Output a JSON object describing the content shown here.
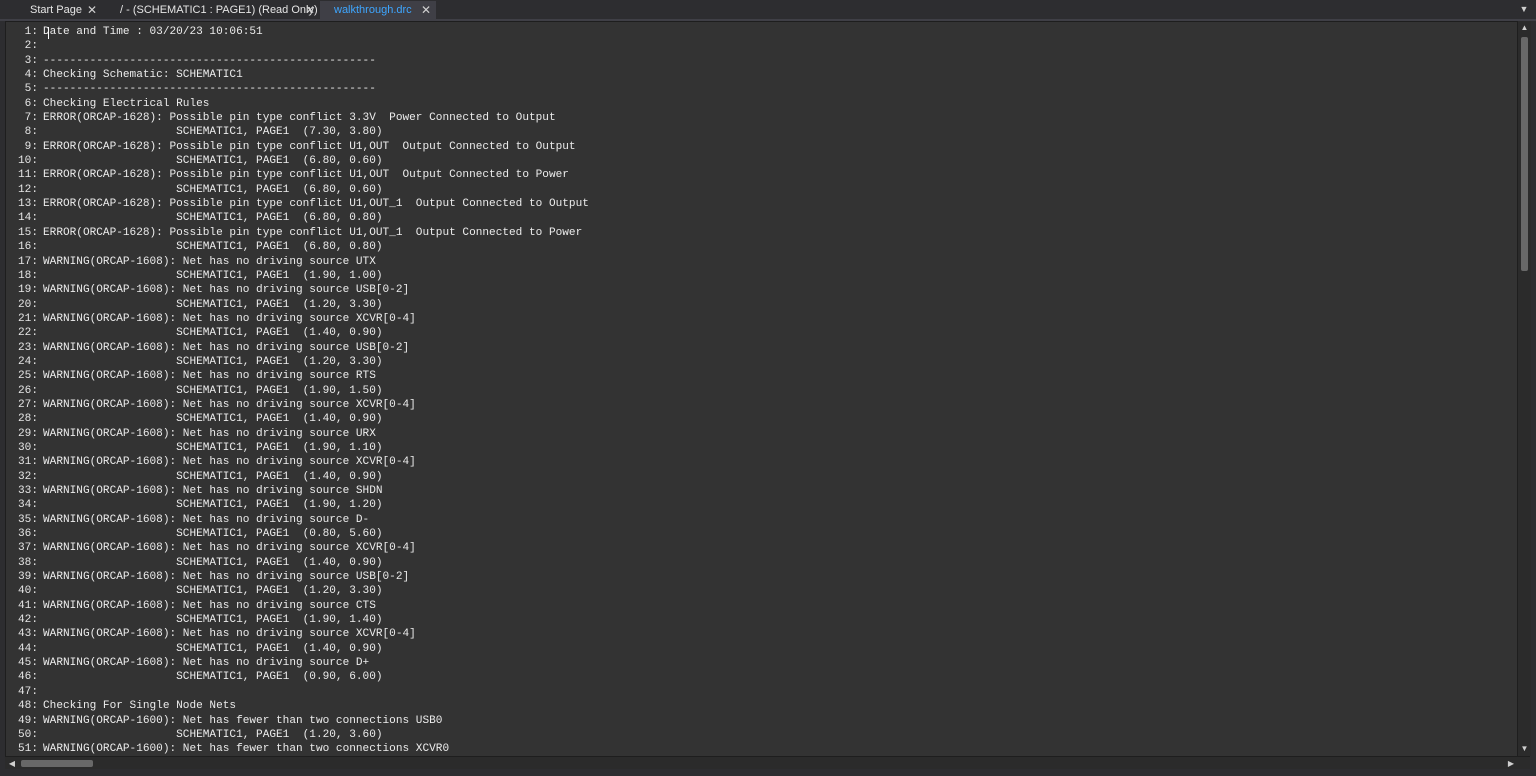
{
  "tabs": [
    {
      "label": "Start Page",
      "close": "✕",
      "active": false
    },
    {
      "label": "/ - (SCHEMATIC1 : PAGE1) (Read Only)",
      "close": "✕",
      "active": false
    },
    {
      "label": "walkthrough.drc",
      "close": "✕",
      "active": true
    }
  ],
  "tab_dropdown_icon": "chevron-down-icon",
  "colors": {
    "active_tab_text": "#3ea6ff",
    "editor_bg": "#333333",
    "text": "#ececec"
  },
  "lines": [
    {
      "num": "1:",
      "text": "Date and Time : 03/20/23 10:06:51"
    },
    {
      "num": "2:",
      "text": ""
    },
    {
      "num": "3:",
      "text": "--------------------------------------------------"
    },
    {
      "num": "4:",
      "text": "Checking Schematic: SCHEMATIC1"
    },
    {
      "num": "5:",
      "text": "--------------------------------------------------"
    },
    {
      "num": "6:",
      "text": "Checking Electrical Rules"
    },
    {
      "num": "7:",
      "text": "ERROR(ORCAP-1628): Possible pin type conflict 3.3V  Power Connected to Output"
    },
    {
      "num": "8:",
      "text": "                    SCHEMATIC1, PAGE1  (7.30, 3.80)"
    },
    {
      "num": "9:",
      "text": "ERROR(ORCAP-1628): Possible pin type conflict U1,OUT  Output Connected to Output"
    },
    {
      "num": "10:",
      "text": "                    SCHEMATIC1, PAGE1  (6.80, 0.60)"
    },
    {
      "num": "11:",
      "text": "ERROR(ORCAP-1628): Possible pin type conflict U1,OUT  Output Connected to Power"
    },
    {
      "num": "12:",
      "text": "                    SCHEMATIC1, PAGE1  (6.80, 0.60)"
    },
    {
      "num": "13:",
      "text": "ERROR(ORCAP-1628): Possible pin type conflict U1,OUT_1  Output Connected to Output"
    },
    {
      "num": "14:",
      "text": "                    SCHEMATIC1, PAGE1  (6.80, 0.80)"
    },
    {
      "num": "15:",
      "text": "ERROR(ORCAP-1628): Possible pin type conflict U1,OUT_1  Output Connected to Power"
    },
    {
      "num": "16:",
      "text": "                    SCHEMATIC1, PAGE1  (6.80, 0.80)"
    },
    {
      "num": "17:",
      "text": "WARNING(ORCAP-1608): Net has no driving source UTX"
    },
    {
      "num": "18:",
      "text": "                    SCHEMATIC1, PAGE1  (1.90, 1.00)"
    },
    {
      "num": "19:",
      "text": "WARNING(ORCAP-1608): Net has no driving source USB[0-2]"
    },
    {
      "num": "20:",
      "text": "                    SCHEMATIC1, PAGE1  (1.20, 3.30)"
    },
    {
      "num": "21:",
      "text": "WARNING(ORCAP-1608): Net has no driving source XCVR[0-4]"
    },
    {
      "num": "22:",
      "text": "                    SCHEMATIC1, PAGE1  (1.40, 0.90)"
    },
    {
      "num": "23:",
      "text": "WARNING(ORCAP-1608): Net has no driving source USB[0-2]"
    },
    {
      "num": "24:",
      "text": "                    SCHEMATIC1, PAGE1  (1.20, 3.30)"
    },
    {
      "num": "25:",
      "text": "WARNING(ORCAP-1608): Net has no driving source RTS"
    },
    {
      "num": "26:",
      "text": "                    SCHEMATIC1, PAGE1  (1.90, 1.50)"
    },
    {
      "num": "27:",
      "text": "WARNING(ORCAP-1608): Net has no driving source XCVR[0-4]"
    },
    {
      "num": "28:",
      "text": "                    SCHEMATIC1, PAGE1  (1.40, 0.90)"
    },
    {
      "num": "29:",
      "text": "WARNING(ORCAP-1608): Net has no driving source URX"
    },
    {
      "num": "30:",
      "text": "                    SCHEMATIC1, PAGE1  (1.90, 1.10)"
    },
    {
      "num": "31:",
      "text": "WARNING(ORCAP-1608): Net has no driving source XCVR[0-4]"
    },
    {
      "num": "32:",
      "text": "                    SCHEMATIC1, PAGE1  (1.40, 0.90)"
    },
    {
      "num": "33:",
      "text": "WARNING(ORCAP-1608): Net has no driving source SHDN"
    },
    {
      "num": "34:",
      "text": "                    SCHEMATIC1, PAGE1  (1.90, 1.20)"
    },
    {
      "num": "35:",
      "text": "WARNING(ORCAP-1608): Net has no driving source D-"
    },
    {
      "num": "36:",
      "text": "                    SCHEMATIC1, PAGE1  (0.80, 5.60)"
    },
    {
      "num": "37:",
      "text": "WARNING(ORCAP-1608): Net has no driving source XCVR[0-4]"
    },
    {
      "num": "38:",
      "text": "                    SCHEMATIC1, PAGE1  (1.40, 0.90)"
    },
    {
      "num": "39:",
      "text": "WARNING(ORCAP-1608): Net has no driving source USB[0-2]"
    },
    {
      "num": "40:",
      "text": "                    SCHEMATIC1, PAGE1  (1.20, 3.30)"
    },
    {
      "num": "41:",
      "text": "WARNING(ORCAP-1608): Net has no driving source CTS"
    },
    {
      "num": "42:",
      "text": "                    SCHEMATIC1, PAGE1  (1.90, 1.40)"
    },
    {
      "num": "43:",
      "text": "WARNING(ORCAP-1608): Net has no driving source XCVR[0-4]"
    },
    {
      "num": "44:",
      "text": "                    SCHEMATIC1, PAGE1  (1.40, 0.90)"
    },
    {
      "num": "45:",
      "text": "WARNING(ORCAP-1608): Net has no driving source D+"
    },
    {
      "num": "46:",
      "text": "                    SCHEMATIC1, PAGE1  (0.90, 6.00)"
    },
    {
      "num": "47:",
      "text": ""
    },
    {
      "num": "48:",
      "text": "Checking For Single Node Nets"
    },
    {
      "num": "49:",
      "text": "WARNING(ORCAP-1600): Net has fewer than two connections USB0"
    },
    {
      "num": "50:",
      "text": "                    SCHEMATIC1, PAGE1  (1.20, 3.60)"
    },
    {
      "num": "51:",
      "text": "WARNING(ORCAP-1600): Net has fewer than two connections XCVR0"
    }
  ]
}
